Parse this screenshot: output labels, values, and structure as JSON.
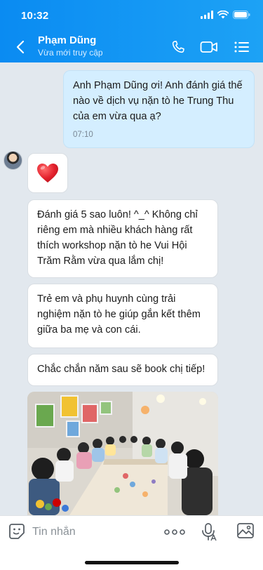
{
  "status_bar": {
    "time": "10:32"
  },
  "header": {
    "contact_name": "Phạm Dũng",
    "contact_status": "Vừa mới truy cập",
    "icons": [
      "back-arrow-icon",
      "phone-icon",
      "video-call-icon",
      "menu-list-icon"
    ]
  },
  "messages": {
    "outgoing": {
      "text": "Anh Phạm Dũng ơi! Anh đánh giá thế nào về dịch vụ nặn tò he Trung Thu của em vừa qua ạ?",
      "time": "07:10"
    },
    "reply_heart": "❤️",
    "reply_1": "Đánh giá 5 sao luôn! ^_^ Không chỉ riêng em mà nhiều khách hàng rất thích workshop nặn tò he Vui Hội Trăm Rằm vừa qua lắm chị!",
    "reply_2": "Trẻ em và phụ huynh cùng trải nghiệm nặn tò he giúp gắn kết thêm giữa ba mẹ và con cái.",
    "reply_3": "Chắc chắn năm sau sẽ book chị tiếp!"
  },
  "composer": {
    "placeholder": "Tin nhắn",
    "icons": [
      "sticker-icon",
      "more-options-icon",
      "voice-record-icon",
      "image-gallery-icon"
    ]
  },
  "colors": {
    "header_start": "#0a8bf2",
    "header_end": "#1da2f5",
    "outgoing_bubble": "#d4eeff",
    "incoming_bubble": "#ffffff",
    "chat_background": "#e2e8ee"
  }
}
